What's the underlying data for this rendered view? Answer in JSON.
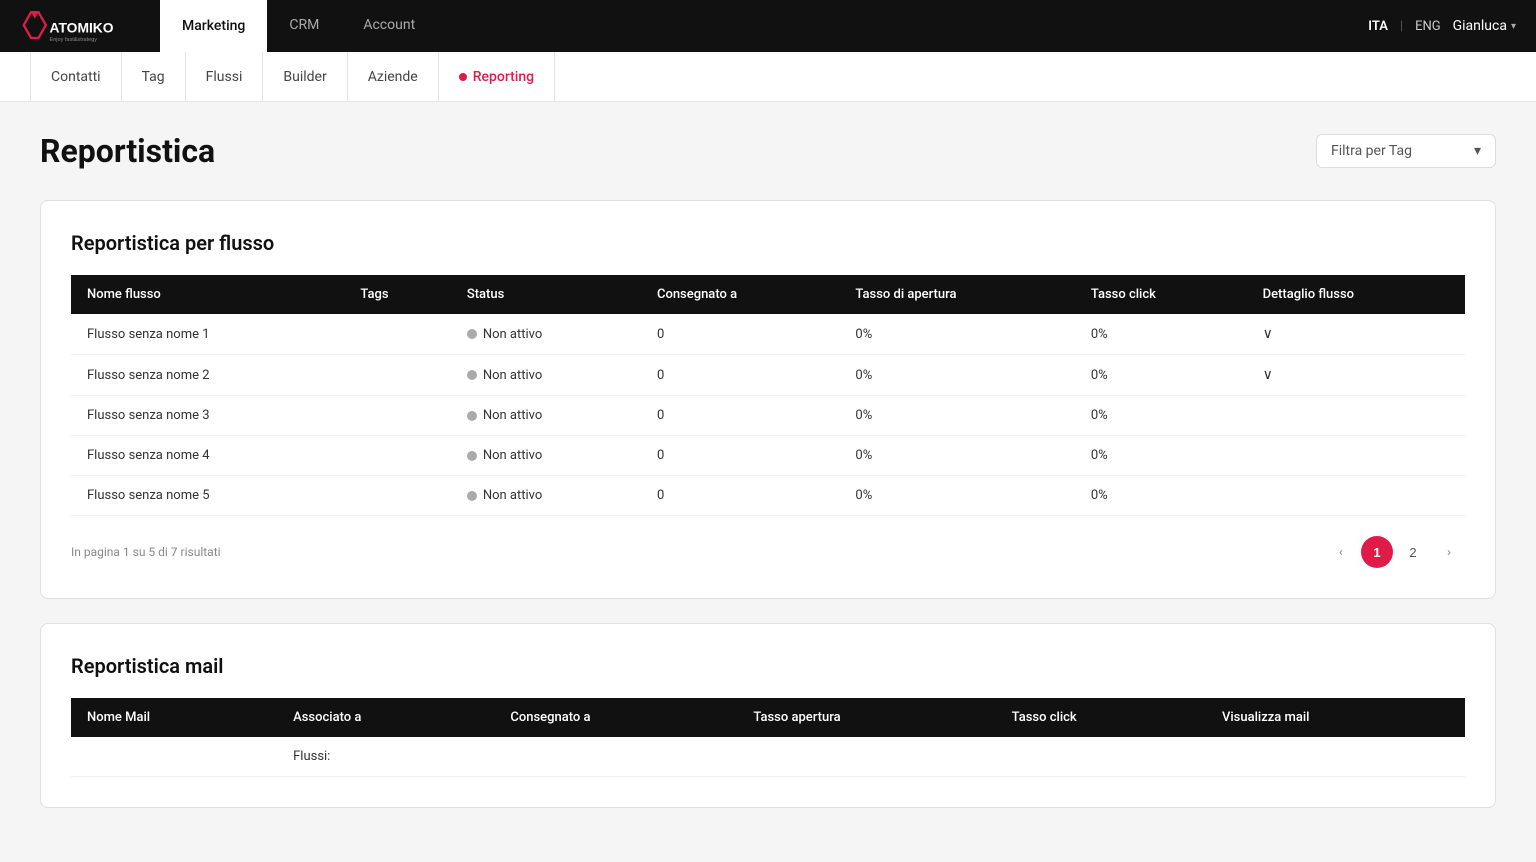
{
  "brand": {
    "name": "ATOMIKO",
    "tagline": "Enjoy fast@strategy"
  },
  "topNav": {
    "tabs": [
      {
        "id": "marketing",
        "label": "Marketing",
        "active": true
      },
      {
        "id": "crm",
        "label": "CRM",
        "active": false
      },
      {
        "id": "account",
        "label": "Account",
        "active": false
      }
    ],
    "languages": [
      "ITA",
      "ENG"
    ],
    "activeLang": "ITA",
    "langSeparator": "|",
    "user": "Gianluca"
  },
  "secondNav": {
    "items": [
      {
        "id": "contatti",
        "label": "Contatti",
        "active": false
      },
      {
        "id": "tag",
        "label": "Tag",
        "active": false
      },
      {
        "id": "flussi",
        "label": "Flussi",
        "active": false
      },
      {
        "id": "builder",
        "label": "Builder",
        "active": false
      },
      {
        "id": "aziende",
        "label": "Aziende",
        "active": false
      },
      {
        "id": "reporting",
        "label": "Reporting",
        "active": true,
        "hasDot": true
      }
    ]
  },
  "page": {
    "title": "Reportistica",
    "filter": {
      "placeholder": "Filtra per Tag"
    }
  },
  "flussoTable": {
    "sectionTitle": "Reportistica per flusso",
    "columns": [
      "Nome flusso",
      "Tags",
      "Status",
      "Consegnato a",
      "Tasso di apertura",
      "Tasso click",
      "Dettaglio flusso"
    ],
    "rows": [
      {
        "nome": "Flusso senza nome 1",
        "tags": "",
        "status": "Non attivo",
        "consegnato": "0",
        "apertura": "0%",
        "click": "0%",
        "hasDetail": true
      },
      {
        "nome": "Flusso senza nome 2",
        "tags": "",
        "status": "Non attivo",
        "consegnato": "0",
        "apertura": "0%",
        "click": "0%",
        "hasDetail": true
      },
      {
        "nome": "Flusso senza nome 3",
        "tags": "",
        "status": "Non attivo",
        "consegnato": "0",
        "apertura": "0%",
        "click": "0%",
        "hasDetail": false
      },
      {
        "nome": "Flusso senza nome 4",
        "tags": "",
        "status": "Non attivo",
        "consegnato": "0",
        "apertura": "0%",
        "click": "0%",
        "hasDetail": false
      },
      {
        "nome": "Flusso senza nome 5",
        "tags": "",
        "status": "Non attivo",
        "consegnato": "0",
        "apertura": "0%",
        "click": "0%",
        "hasDetail": false
      }
    ],
    "pagination": {
      "info": "In pagina 1 su 5 di 7 risultati",
      "currentPage": 1,
      "totalPages": 2,
      "pages": [
        "1",
        "2"
      ]
    }
  },
  "mailTable": {
    "sectionTitle": "Reportistica mail",
    "columns": [
      "Nome Mail",
      "Associato a",
      "Consegnato a",
      "Tasso apertura",
      "Tasso click",
      "Visualizza mail"
    ],
    "firstRowLabel": "Flussi:"
  }
}
